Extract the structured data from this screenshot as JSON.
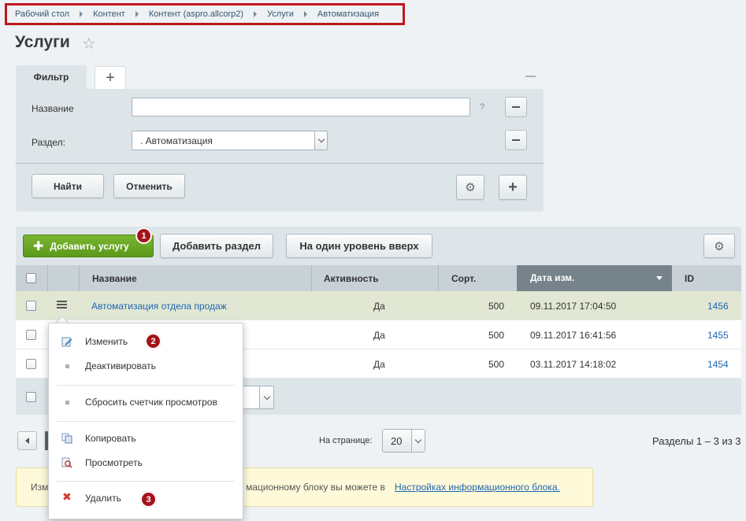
{
  "breadcrumb": [
    "Рабочий стол",
    "Контент",
    "Контент (aspro.allcorp2)",
    "Услуги",
    "Автоматизация"
  ],
  "page": {
    "title": "Услуги"
  },
  "filter": {
    "tab_label": "Фильтр",
    "name_label": "Название",
    "name_value": "",
    "help_mark": "?",
    "section_label": "Раздел:",
    "section_value": ". Автоматизация",
    "find_label": "Найти",
    "cancel_label": "Отменить"
  },
  "toolbar": {
    "add_service": "Добавить услугу",
    "add_section": "Добавить раздел",
    "level_up": "На один уровень вверх"
  },
  "badges": [
    "1",
    "2",
    "3"
  ],
  "table": {
    "columns": [
      "Название",
      "Активность",
      "Сорт.",
      "Дата изм.",
      "ID"
    ],
    "rows": [
      {
        "name": "Автоматизация отдела продаж",
        "active": "Да",
        "sort": "500",
        "date": "09.11.2017 17:04:50",
        "id": "1456"
      },
      {
        "name": "",
        "active": "Да",
        "sort": "500",
        "date": "09.11.2017 16:41:56",
        "id": "1455"
      },
      {
        "name": "",
        "active": "Да",
        "sort": "500",
        "date": "03.11.2017 14:18:02",
        "id": "1454"
      }
    ]
  },
  "pagination": {
    "per_page_label": "На странице:",
    "per_page_value": "20",
    "summary": "Разделы 1 – 3 из 3"
  },
  "info": {
    "prefix": "Изм",
    "text": "мационному блоку вы можете в",
    "link": "Настройках информационного блока."
  },
  "context_menu": {
    "edit": "Изменить",
    "deactivate": "Деактивировать",
    "reset_views": "Сбросить счетчик просмотров",
    "copy": "Копировать",
    "view": "Просмотреть",
    "delete": "Удалить"
  },
  "colors": {
    "accent_green": "#6aa726",
    "badge_red": "#a4131b",
    "highlight_red": "#c0161d",
    "link_blue": "#2066b0"
  }
}
